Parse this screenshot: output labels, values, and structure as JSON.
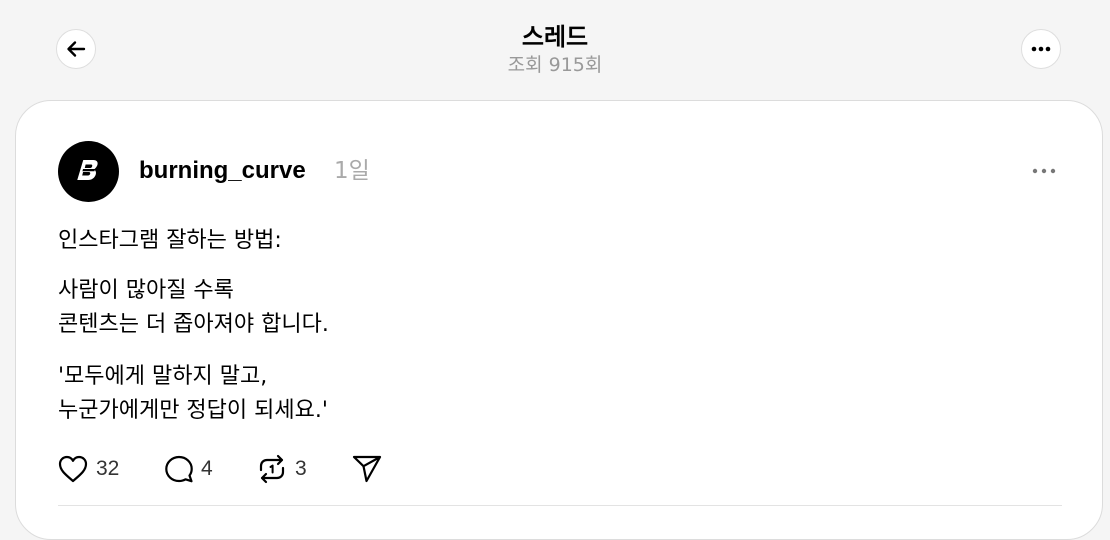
{
  "header": {
    "title": "스레드",
    "views": "조회 915회"
  },
  "post": {
    "author": "burning_curve",
    "time": "1일",
    "paragraphs": [
      [
        "인스타그램 잘하는 방법:"
      ],
      [
        "사람이 많아질 수록",
        "콘텐츠는 더 좁아져야 합니다."
      ],
      [
        "'모두에게 말하지 말고,",
        "누군가에게만 정답이 되세요.'"
      ]
    ],
    "actions": {
      "likes": "32",
      "replies": "4",
      "reposts": "3"
    }
  },
  "icons": {
    "back": "arrow-left-icon",
    "header_more": "more-horizontal-icon",
    "avatar_logo": "letter-b-logo",
    "post_more": "more-horizontal-icon",
    "like": "heart-icon",
    "reply": "comment-icon",
    "repost": "repost-icon",
    "share": "send-icon"
  }
}
